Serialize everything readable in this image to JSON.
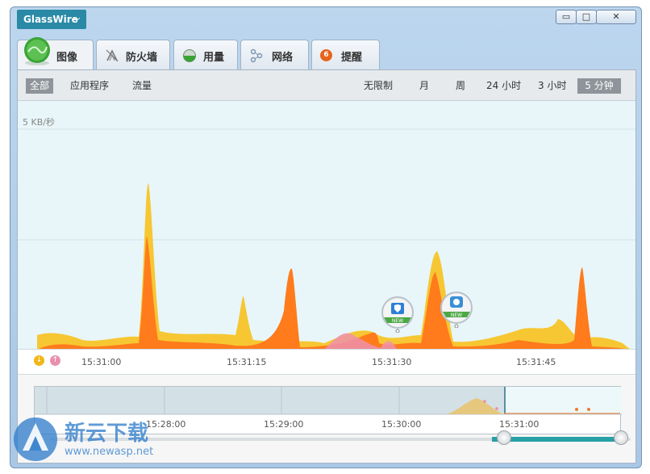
{
  "app": {
    "title": "GlassWire"
  },
  "window_controls": {
    "minimize": "▭",
    "maximize": "□",
    "close": "✕"
  },
  "tabs": [
    {
      "label": "图像",
      "icon": "graph-icon"
    },
    {
      "label": "防火墙",
      "icon": "firewall-icon"
    },
    {
      "label": "用量",
      "icon": "usage-icon"
    },
    {
      "label": "网络",
      "icon": "network-icon"
    },
    {
      "label": "提醒",
      "icon": "alert-icon",
      "badge": "6"
    }
  ],
  "filters": {
    "all": "全部",
    "apps": "应用程序",
    "traffic": "流量"
  },
  "time_ranges": [
    {
      "label": "无限制"
    },
    {
      "label": "月"
    },
    {
      "label": "周"
    },
    {
      "label": "24 小时"
    },
    {
      "label": "3 小时"
    },
    {
      "label": "5 分钟",
      "selected": true
    }
  ],
  "chart": {
    "ylabel": "5 KB/秒",
    "pins": [
      {
        "label": "NEW"
      },
      {
        "label": "NEW"
      }
    ]
  },
  "timeline": {
    "ticks": [
      "15:31:00",
      "15:31:15",
      "15:31:30",
      "15:31:45"
    ]
  },
  "overview": {
    "ticks": [
      "15:28:00",
      "15:29:00",
      "15:30:00",
      "15:31:00"
    ]
  },
  "watermark": {
    "brand": "新云下载",
    "url": "www.newasp.net"
  },
  "colors": {
    "incoming": "#f5a623",
    "outgoing": "#ff7b1c",
    "highlight": "#f1c232",
    "accent": "#27a0a6"
  }
}
